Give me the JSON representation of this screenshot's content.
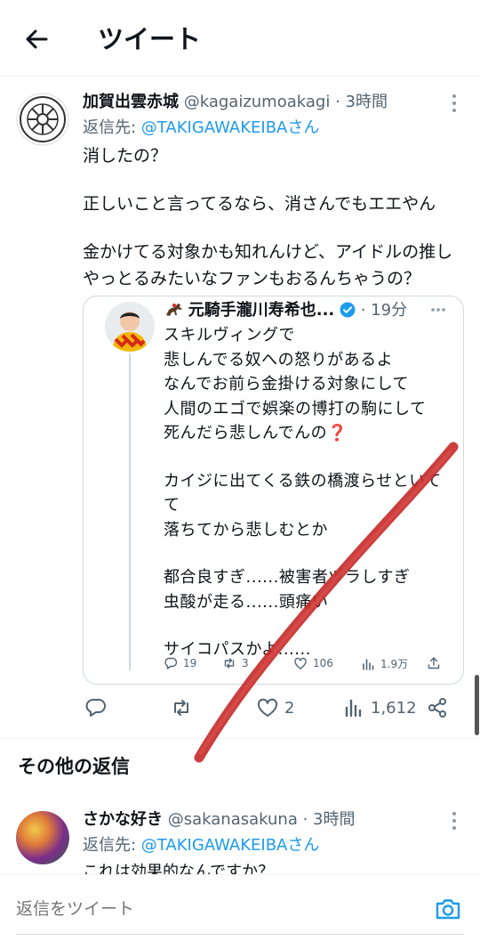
{
  "header": {
    "title": "ツイート",
    "back_icon": "arrow-left-icon"
  },
  "tweet": {
    "name": "加賀出雲赤城",
    "handle": "@kagaizumoakagi",
    "time": "· 3時間",
    "reply_prefix": "返信先: ",
    "reply_to": "@TAKIGAWAKEIBAさん",
    "lines": [
      "消したの？",
      "正しいこと言ってるなら、消さんでもエエやん",
      "金かけてる対象かも知れんけど、アイドルの推し",
      "やっとるみたいなファンもおるんちゃうの？"
    ],
    "quote": {
      "name": "元騎手瀧川寿希也...",
      "time": "· 19分",
      "lines": [
        "スキルヴィングで",
        "悲しんでる奴への怒りがあるよ",
        "なんでお前ら金掛ける対象にして",
        "人間のエゴで娯楽の博打の駒にして",
        "死んだら悲しんでんの",
        "❓",
        "カイジに出てくる鉄の橋渡らせといて",
        "て",
        "落ちてから悲しむとか",
        "都合良すぎ......被害者ヅラしすぎ",
        "虫酸が走る......頭痛い",
        "サイコパスかよ......"
      ],
      "stats": {
        "replies": "19",
        "retweets": "3",
        "likes": "106",
        "views": "1.9万"
      }
    },
    "stats": {
      "likes": "2",
      "views": "1,612"
    }
  },
  "section_title": "その他の返信",
  "reply": {
    "name": "さかな好き",
    "handle": "@sakanasakuna",
    "time": "· 3時間",
    "reply_prefix": "返信先: ",
    "reply_to": "@TAKIGAWAKEIBAさん",
    "text": "これは効果的なんですか？"
  },
  "compose": {
    "placeholder": "返信をツイート"
  },
  "colors": {
    "link": "#1d9bf0",
    "annotation_stroke": "#c62828",
    "muted": "#536471"
  }
}
